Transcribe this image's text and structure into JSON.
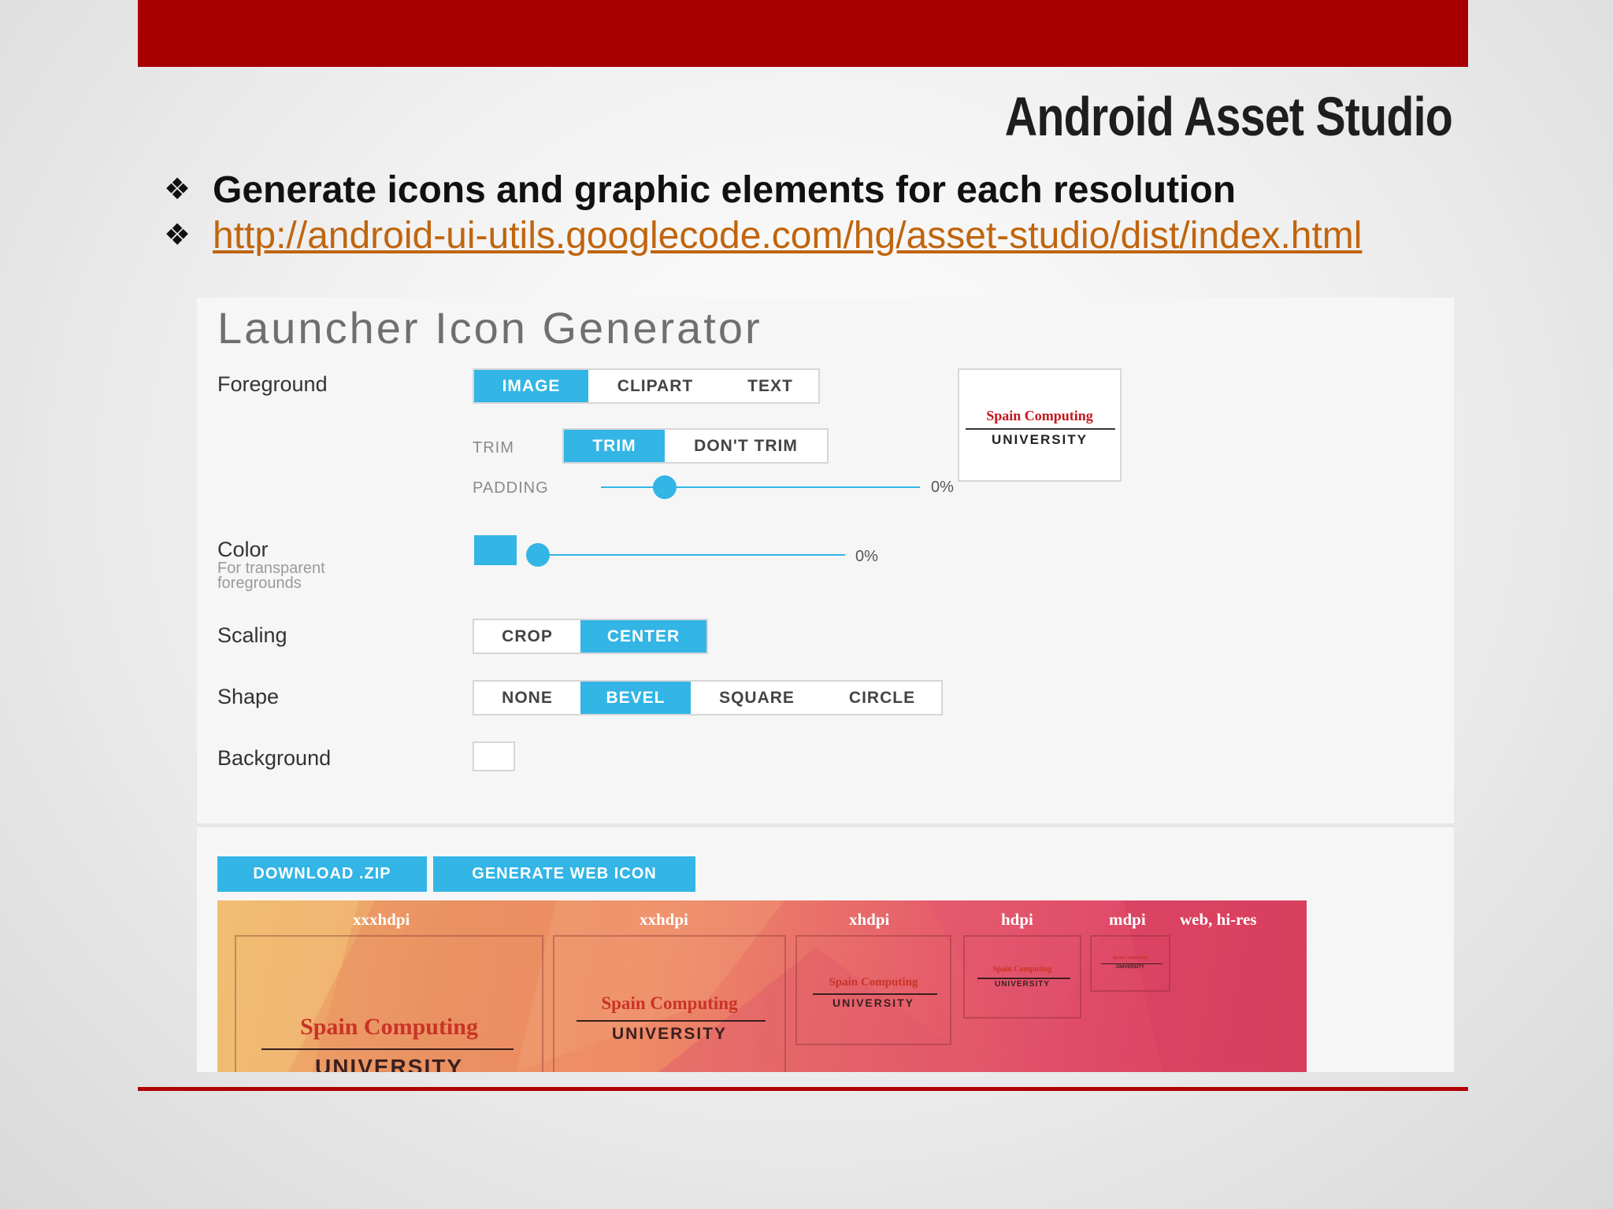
{
  "slide": {
    "title": "Android Asset Studio",
    "bullets": [
      {
        "mark": "❖",
        "text": "Generate icons and graphic elements for each resolution"
      },
      {
        "mark": "❖",
        "link": "http://android-ui-utils.googlecode.com/hg/asset-studio/dist/index.html"
      }
    ]
  },
  "generator": {
    "title": "Launcher Icon Generator",
    "foreground": {
      "label": "Foreground",
      "tabs": [
        "IMAGE",
        "CLIPART",
        "TEXT"
      ],
      "selected_tab": "IMAGE",
      "trim_label": "TRIM",
      "trim_options": [
        "TRIM",
        "DON'T TRIM"
      ],
      "trim_selected": "TRIM",
      "padding_label": "PADDING",
      "padding_value": "0%",
      "padding_fraction": 0.2
    },
    "color": {
      "label": "Color",
      "sublabel": "For transparent foregrounds",
      "swatch": "#33b5e5",
      "value": "0%",
      "fraction": 0.0
    },
    "scaling": {
      "label": "Scaling",
      "options": [
        "CROP",
        "CENTER"
      ],
      "selected": "CENTER"
    },
    "shape": {
      "label": "Shape",
      "options": [
        "NONE",
        "BEVEL",
        "SQUARE",
        "CIRCLE"
      ],
      "selected": "BEVEL"
    },
    "background": {
      "label": "Background",
      "swatch": "#ffffff"
    },
    "preview_logo": {
      "line1": "Spain Computing",
      "line2": "UNIVERSITY"
    },
    "actions": {
      "download": "DOWNLOAD .ZIP",
      "web_icon": "GENERATE WEB ICON"
    },
    "densities": [
      {
        "label": "xxxhdpi",
        "logo1": "Spain Computing",
        "logo2": "UNIVERSITY"
      },
      {
        "label": "xxhdpi",
        "logo1": "Spain Computing",
        "logo2": "UNIVERSITY"
      },
      {
        "label": "xhdpi",
        "logo1": "Spain Computing",
        "logo2": "UNIVERSITY"
      },
      {
        "label": "hdpi",
        "logo1": "Spain Computing",
        "logo2": "UNIVERSITY"
      },
      {
        "label": "mdpi",
        "logo1": "Spain Computing",
        "logo2": "UNIVERSITY"
      },
      {
        "label": "web, hi-res"
      }
    ]
  },
  "colors": {
    "accent": "#33b5e5",
    "brand_red": "#a80000",
    "link": "#c0650e"
  }
}
